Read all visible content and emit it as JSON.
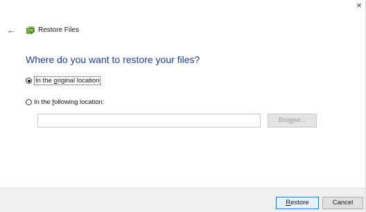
{
  "window": {
    "title": "Restore Files",
    "close_glyph": "×",
    "back_glyph": "←",
    "icons": {
      "app": "restore-files-icon",
      "back": "back-arrow-icon",
      "close": "close-icon"
    }
  },
  "main": {
    "heading": "Where do you want to restore your files?",
    "options": [
      {
        "pre": "In the ",
        "accel": "o",
        "post": "riginal location",
        "checked": true
      },
      {
        "pre": "In the ",
        "accel": "f",
        "post": "ollowing location:",
        "checked": false
      }
    ],
    "location_input": {
      "value": "",
      "placeholder": ""
    },
    "browse_button": {
      "pre": "Bro",
      "accel": "w",
      "post": "se...",
      "enabled": false
    }
  },
  "footer": {
    "restore_button": {
      "pre": "",
      "accel": "R",
      "post": "estore"
    },
    "cancel_button": "Cancel"
  },
  "colors": {
    "heading": "#1e3c8c",
    "footer_bg": "#f0f0f0",
    "default_button_border": "#0078d7"
  }
}
